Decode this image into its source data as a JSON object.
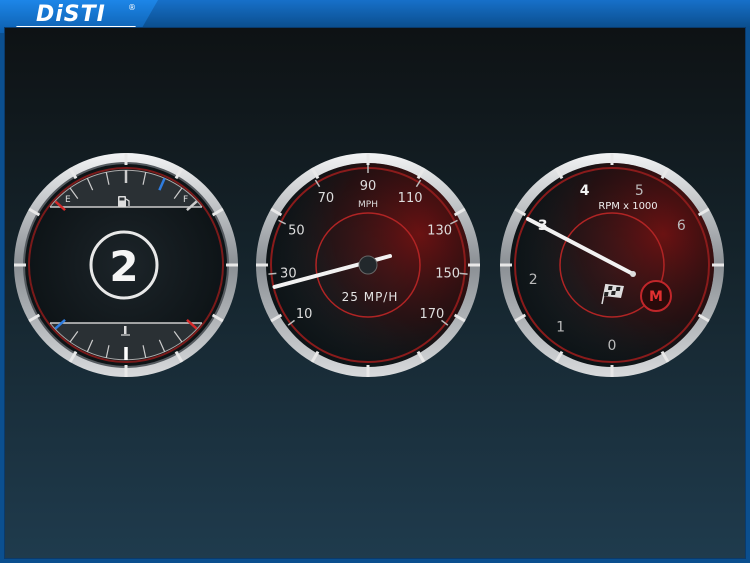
{
  "app": {
    "logo_text": "DiSTI",
    "logo_mark": "®"
  },
  "colors": {
    "bezel": "#c9ccd0",
    "needle": "#f2f2f2",
    "accent_red": "#d42a2a",
    "accent_blue": "#2f7de0"
  },
  "left_gauge": {
    "gear": "2",
    "fuel": {
      "empty_label": "E",
      "full_label": "F",
      "icon": "fuel-pump-icon",
      "level": 0.75
    },
    "temperature": {
      "icon": "coolant-temp-icon",
      "level": 0.55
    }
  },
  "speedometer": {
    "unit_label": "MPH",
    "readout": "25 MP/H",
    "speed_value": 25,
    "scale_labels": [
      "10",
      "30",
      "50",
      "70",
      "90",
      "110",
      "130",
      "150",
      "170"
    ]
  },
  "tachometer": {
    "unit_label": "RPM x 1000",
    "rpm_value": 3.3,
    "scale_labels": [
      "0",
      "1",
      "2",
      "3",
      "4",
      "5",
      "6"
    ],
    "mode_label": "M",
    "flag_icon": "checkered-flag-icon"
  }
}
